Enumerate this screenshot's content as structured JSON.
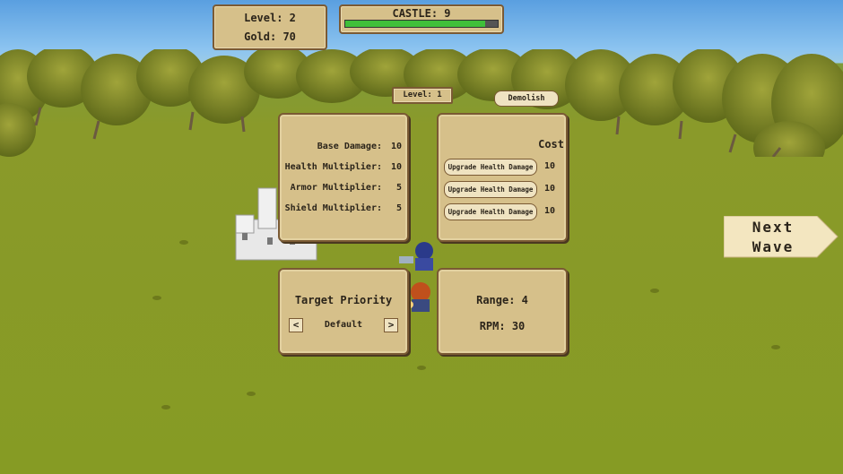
{
  "hud": {
    "level_label": "Level: 2",
    "gold_label": "Gold: 70",
    "castle_label": "CASTLE: 9",
    "castle_health_fraction": 0.92
  },
  "tower": {
    "level_label": "Level: 1",
    "demolish_label": "Demolish"
  },
  "stats": [
    {
      "label": "Base Damage:",
      "value": "10"
    },
    {
      "label": "Health Multiplier:",
      "value": "10"
    },
    {
      "label": "Armor Multiplier:",
      "value": "5"
    },
    {
      "label": "Shield Multiplier:",
      "value": "5"
    }
  ],
  "upgrades": {
    "header": "Cost",
    "items": [
      {
        "label": "Upgrade Health Damage",
        "cost": "10"
      },
      {
        "label": "Upgrade Health Damage",
        "cost": "10"
      },
      {
        "label": "Upgrade Health Damage",
        "cost": "10"
      }
    ]
  },
  "targeting": {
    "title": "Target Priority",
    "prev": "<",
    "value": "Default",
    "next": ">"
  },
  "tower_info": {
    "range": "Range: 4",
    "rpm": "RPM: 30"
  },
  "next_wave": {
    "line1": "Next",
    "line2": "Wave"
  },
  "colors": {
    "panel": "#d6c08a",
    "border": "#7a5a34",
    "health": "#3fbf3a",
    "grass": "#869b24",
    "sky": "#5a9fe0"
  }
}
